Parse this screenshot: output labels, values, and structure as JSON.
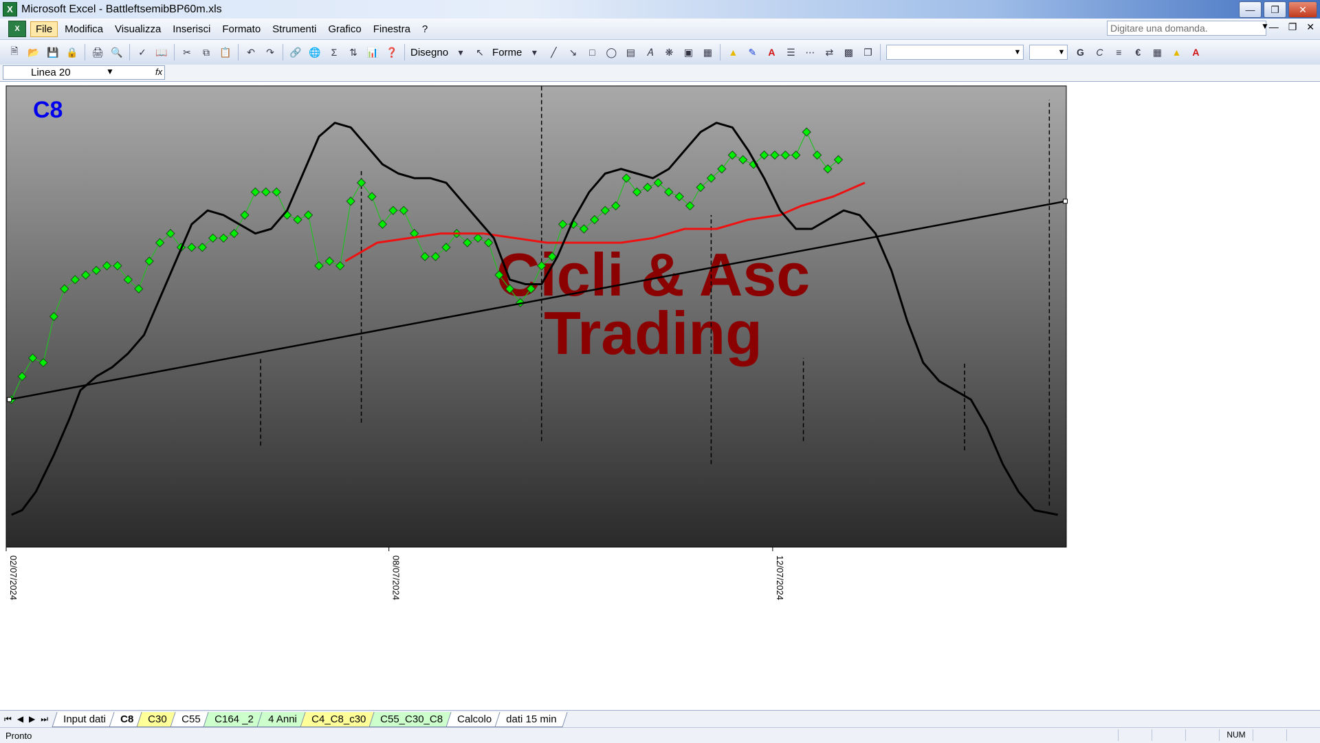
{
  "window": {
    "title": "Microsoft Excel - BattleftsemibBP60m.xls",
    "app_icon": "excel-icon",
    "controls": [
      "minimize-icon",
      "maximize-icon",
      "close-icon"
    ]
  },
  "menu": {
    "items": [
      "File",
      "Modifica",
      "Visualizza",
      "Inserisci",
      "Formato",
      "Strumenti",
      "Grafico",
      "Finestra",
      "?"
    ],
    "active": "File",
    "ask_placeholder": "Digitare una domanda."
  },
  "toolbar": {
    "draw_label": "Disegno",
    "shapes_label": "Forme",
    "font_name": "",
    "font_size": "",
    "bold_label": "G",
    "italic_label": "C",
    "euro_label": "€"
  },
  "namebox": {
    "value": "Linea 20",
    "fx_label": "fx"
  },
  "chart_data": {
    "type": "line",
    "title": "C8",
    "watermark": [
      "Cicli & Asc",
      "Trading"
    ],
    "x_tick_labels": [
      "02/07/2024",
      "08/07/2024",
      "12/07/2024"
    ],
    "background_gradient": [
      "#a9a9a9",
      "#2a2a2a"
    ],
    "colors": {
      "price": "#00ee00",
      "price_line": "#20c020",
      "average": "#ee1111",
      "cycle": "#000000",
      "trend": "#000000",
      "title": "#0000ee",
      "watermark": "#8b0000"
    },
    "y_range": [
      0,
      100
    ],
    "x_range": [
      0,
      100
    ],
    "series": [
      {
        "kind": "price-diamonds",
        "points": [
          [
            0.5,
            32
          ],
          [
            1.5,
            37
          ],
          [
            2.5,
            41
          ],
          [
            3.5,
            40
          ],
          [
            4.5,
            50
          ],
          [
            5.5,
            56
          ],
          [
            6.5,
            58
          ],
          [
            7.5,
            59
          ],
          [
            8.5,
            60
          ],
          [
            9.5,
            61
          ],
          [
            10.5,
            61
          ],
          [
            11.5,
            58
          ],
          [
            12.5,
            56
          ],
          [
            13.5,
            62
          ],
          [
            14.5,
            66
          ],
          [
            15.5,
            68
          ],
          [
            16.5,
            65
          ],
          [
            17.5,
            65
          ],
          [
            18.5,
            65
          ],
          [
            19.5,
            67
          ],
          [
            20.5,
            67
          ],
          [
            21.5,
            68
          ],
          [
            22.5,
            72
          ],
          [
            23.5,
            77
          ],
          [
            24.5,
            77
          ],
          [
            25.5,
            77
          ],
          [
            26.5,
            72
          ],
          [
            27.5,
            71
          ],
          [
            28.5,
            72
          ],
          [
            29.5,
            61
          ],
          [
            30.5,
            62
          ],
          [
            31.5,
            61
          ],
          [
            32.5,
            75
          ],
          [
            33.5,
            79
          ],
          [
            34.5,
            76
          ],
          [
            35.5,
            70
          ],
          [
            36.5,
            73
          ],
          [
            37.5,
            73
          ],
          [
            38.5,
            68
          ],
          [
            39.5,
            63
          ],
          [
            40.5,
            63
          ],
          [
            41.5,
            65
          ],
          [
            42.5,
            68
          ],
          [
            43.5,
            66
          ],
          [
            44.5,
            67
          ],
          [
            45.5,
            66
          ],
          [
            46.5,
            59
          ],
          [
            47.5,
            56
          ],
          [
            48.5,
            53
          ],
          [
            49.5,
            56
          ],
          [
            50.5,
            61
          ],
          [
            51.5,
            63
          ],
          [
            52.5,
            70
          ],
          [
            53.5,
            70
          ],
          [
            54.5,
            69
          ],
          [
            55.5,
            71
          ],
          [
            56.5,
            73
          ],
          [
            57.5,
            74
          ],
          [
            58.5,
            80
          ],
          [
            59.5,
            77
          ],
          [
            60.5,
            78
          ],
          [
            61.5,
            79
          ],
          [
            62.5,
            77
          ],
          [
            63.5,
            76
          ],
          [
            64.5,
            74
          ],
          [
            65.5,
            78
          ],
          [
            66.5,
            80
          ],
          [
            67.5,
            82
          ],
          [
            68.5,
            85
          ],
          [
            69.5,
            84
          ],
          [
            70.5,
            83
          ],
          [
            71.5,
            85
          ],
          [
            72.5,
            85
          ],
          [
            73.5,
            85
          ],
          [
            74.5,
            85
          ],
          [
            75.5,
            90
          ],
          [
            76.5,
            85
          ],
          [
            77.5,
            82
          ],
          [
            78.5,
            84
          ]
        ]
      },
      {
        "kind": "average-line",
        "points": [
          [
            32,
            62
          ],
          [
            35,
            66
          ],
          [
            38,
            67
          ],
          [
            41,
            68
          ],
          [
            45,
            68
          ],
          [
            48,
            67
          ],
          [
            51,
            66
          ],
          [
            55,
            66
          ],
          [
            58,
            66
          ],
          [
            61,
            67
          ],
          [
            64,
            69
          ],
          [
            67,
            69
          ],
          [
            70,
            71
          ],
          [
            73,
            72
          ],
          [
            75,
            74
          ],
          [
            78,
            76
          ],
          [
            81,
            79
          ]
        ]
      },
      {
        "kind": "cycle-line",
        "points": [
          [
            0.5,
            7
          ],
          [
            1.5,
            8
          ],
          [
            2.8,
            12
          ],
          [
            4.5,
            20
          ],
          [
            6,
            28
          ],
          [
            7,
            34
          ],
          [
            8.5,
            37
          ],
          [
            10,
            39
          ],
          [
            11.5,
            42
          ],
          [
            13,
            46
          ],
          [
            14.5,
            54
          ],
          [
            16,
            62
          ],
          [
            17.5,
            70
          ],
          [
            19,
            73
          ],
          [
            20.5,
            72
          ],
          [
            22,
            70
          ],
          [
            23.5,
            68
          ],
          [
            25,
            69
          ],
          [
            26.5,
            73
          ],
          [
            28,
            81
          ],
          [
            29.5,
            89
          ],
          [
            31,
            92
          ],
          [
            32.5,
            91
          ],
          [
            34,
            87
          ],
          [
            35.5,
            83
          ],
          [
            37,
            81
          ],
          [
            38.5,
            80
          ],
          [
            40,
            80
          ],
          [
            41.5,
            79
          ],
          [
            43,
            75
          ],
          [
            44.5,
            71
          ],
          [
            46,
            67
          ],
          [
            47.5,
            58
          ],
          [
            49,
            57
          ],
          [
            50.5,
            57
          ],
          [
            52,
            63
          ],
          [
            53.5,
            71
          ],
          [
            55,
            77
          ],
          [
            56.5,
            81
          ],
          [
            58,
            82
          ],
          [
            59.5,
            81
          ],
          [
            61,
            80
          ],
          [
            62.5,
            82
          ],
          [
            64,
            86
          ],
          [
            65.5,
            90
          ],
          [
            67,
            92
          ],
          [
            68.5,
            91
          ],
          [
            70,
            86
          ],
          [
            71.5,
            80
          ],
          [
            73,
            73
          ],
          [
            74.5,
            69
          ],
          [
            76,
            69
          ],
          [
            77.5,
            71
          ],
          [
            79,
            73
          ],
          [
            80.5,
            72
          ],
          [
            82,
            68
          ],
          [
            83.5,
            60
          ],
          [
            85,
            49
          ],
          [
            86.5,
            40
          ],
          [
            88,
            36
          ],
          [
            89.5,
            34
          ],
          [
            91,
            32
          ],
          [
            92.5,
            26
          ],
          [
            94,
            18
          ],
          [
            95.5,
            12
          ],
          [
            97,
            8
          ],
          [
            99.2,
            7
          ]
        ]
      },
      {
        "kind": "trend-line",
        "points": [
          [
            0.3,
            32
          ],
          [
            99.9,
            75
          ]
        ]
      }
    ],
    "cycle_markers": [
      {
        "x": 24,
        "y_from": 22,
        "y_to": 41
      },
      {
        "x": 33.5,
        "y_from": 27,
        "y_to": 82
      },
      {
        "x": 50.5,
        "y_from": 23,
        "y_to": 100
      },
      {
        "x": 66.5,
        "y_from": 18,
        "y_to": 72
      },
      {
        "x": 75.2,
        "y_from": 23,
        "y_to": 41
      },
      {
        "x": 90.4,
        "y_from": 21,
        "y_to": 40
      },
      {
        "x": 98.4,
        "y_from": 9,
        "y_to": 97
      }
    ],
    "x_ticks_at": [
      0,
      36.1,
      72.3
    ]
  },
  "sheet_tabs": [
    {
      "label": "Input dati",
      "color": "white"
    },
    {
      "label": "C8",
      "color": "white",
      "active": true
    },
    {
      "label": "C30",
      "color": "yellow"
    },
    {
      "label": "C55",
      "color": "white"
    },
    {
      "label": "C164 _2",
      "color": "green"
    },
    {
      "label": "4 Anni",
      "color": "green"
    },
    {
      "label": "C4_C8_c30",
      "color": "yellow"
    },
    {
      "label": "C55_C30_C8",
      "color": "green"
    },
    {
      "label": "Calcolo",
      "color": "white"
    },
    {
      "label": "dati 15 min",
      "color": "white"
    }
  ],
  "status": {
    "text": "Pronto",
    "num_label": "NUM"
  }
}
